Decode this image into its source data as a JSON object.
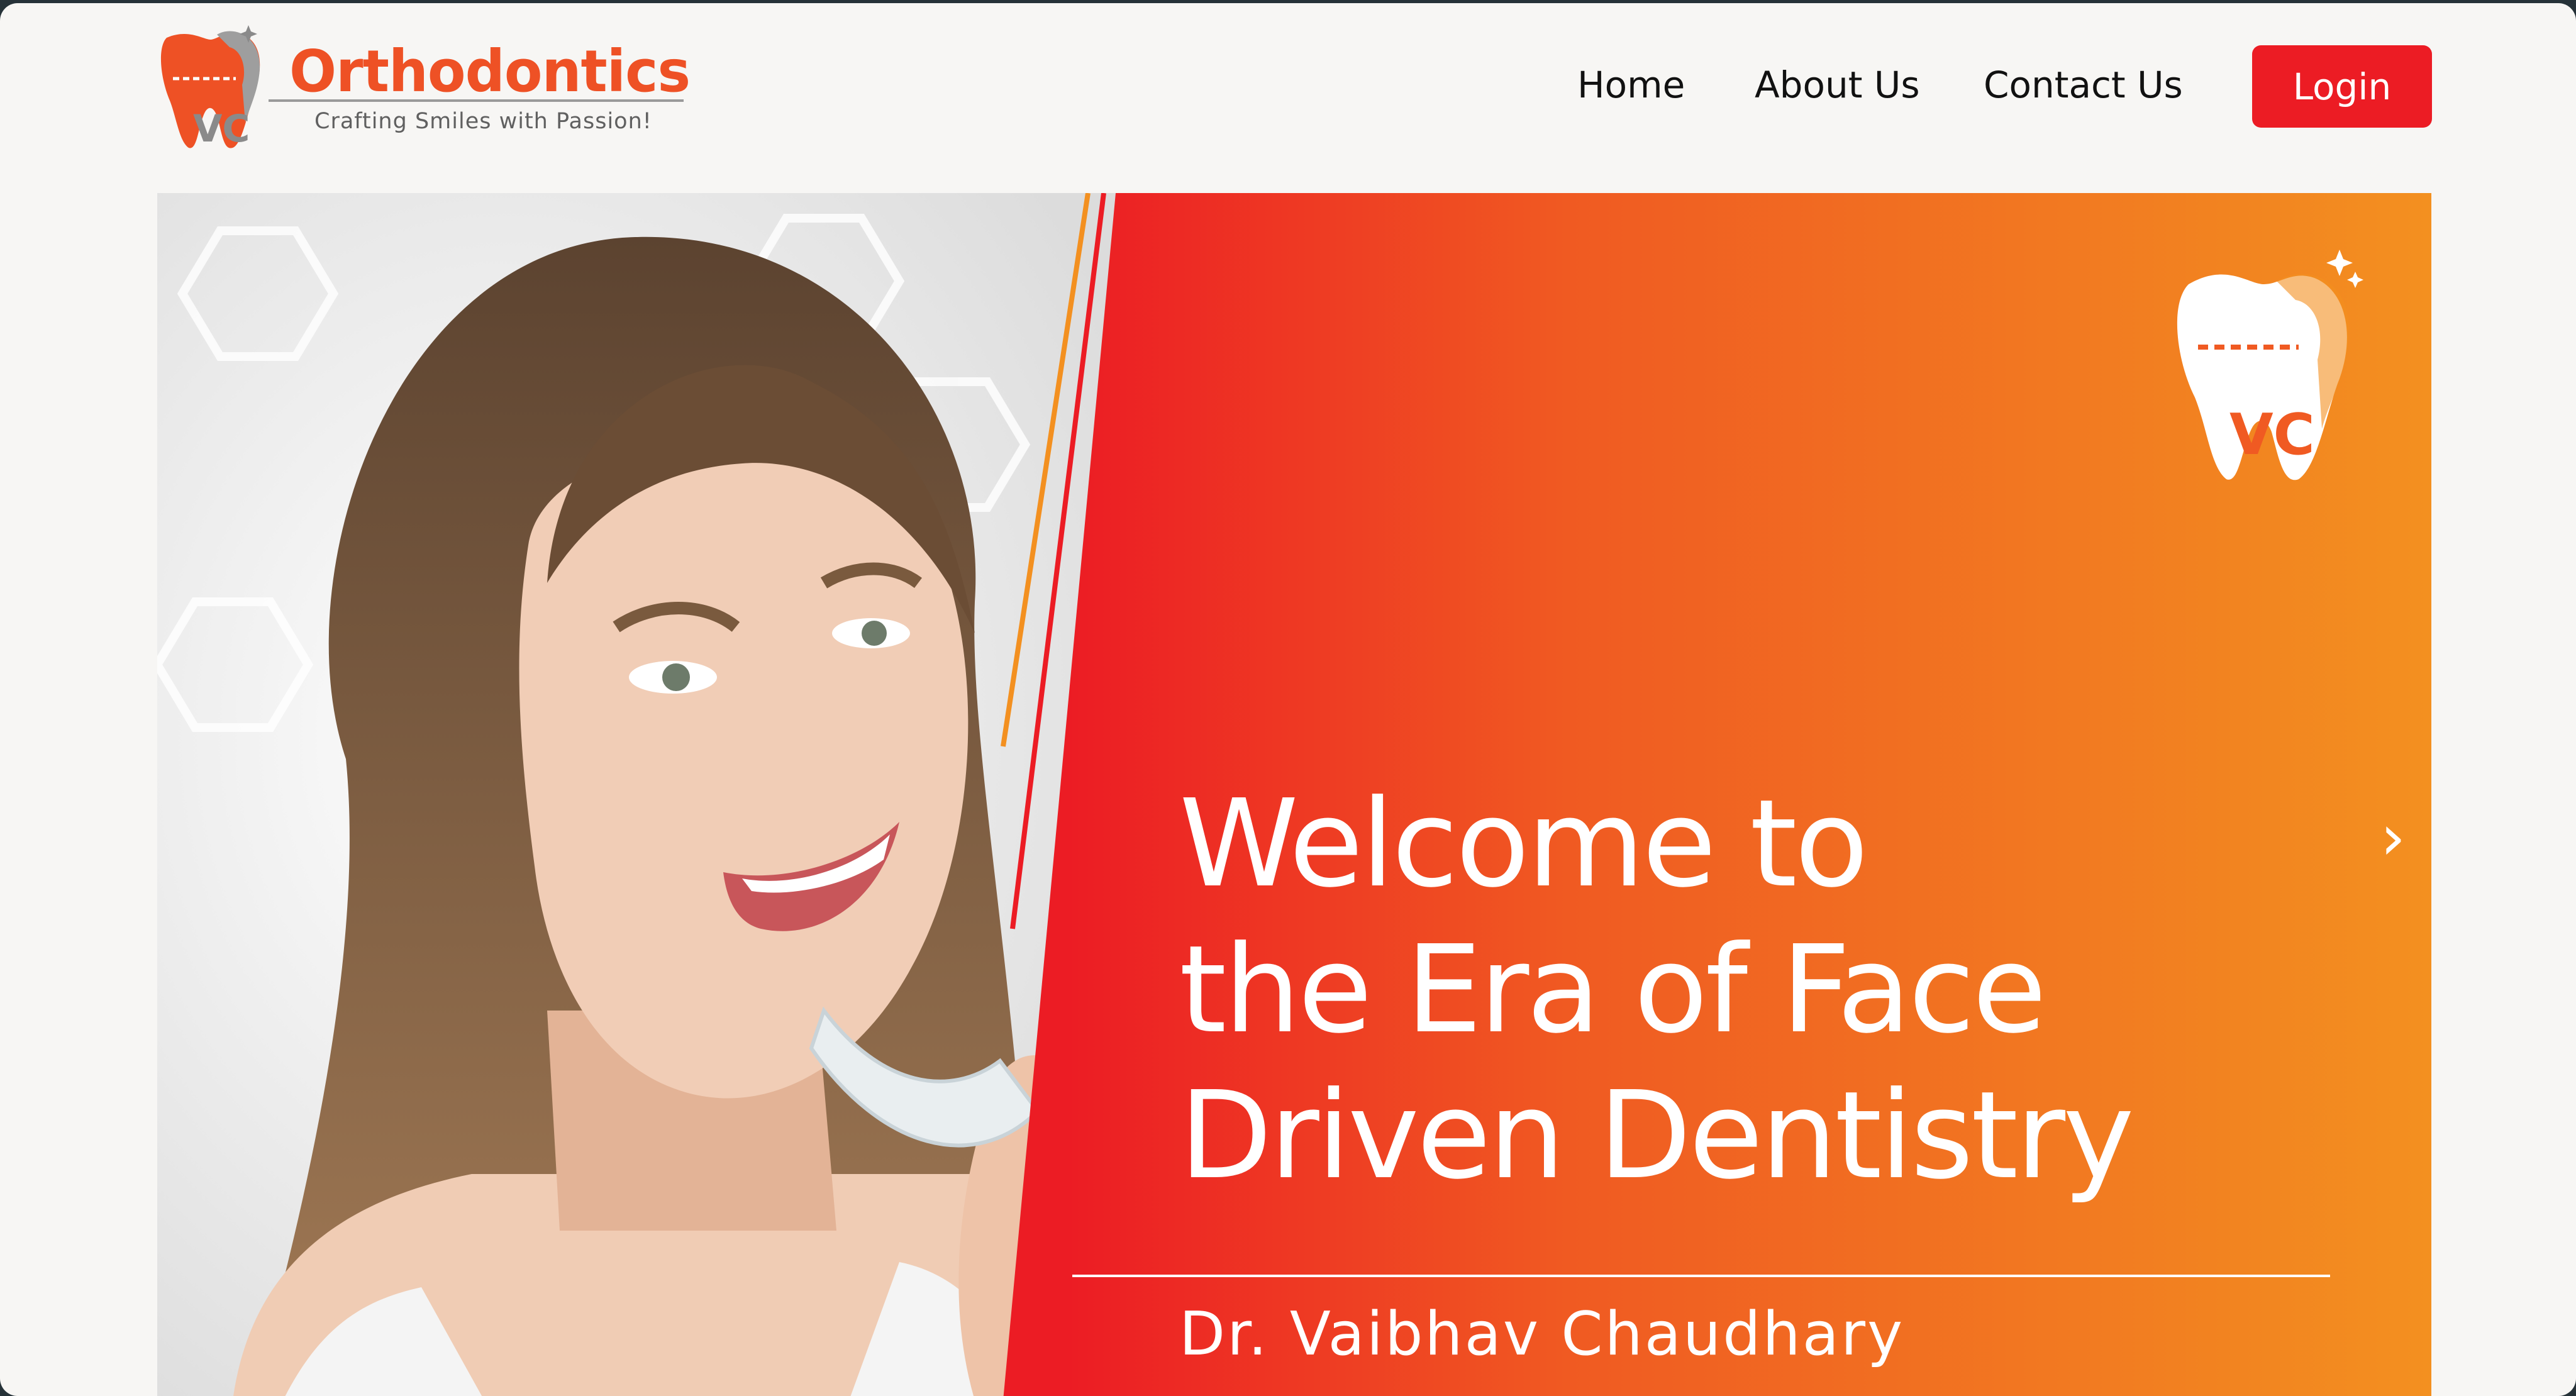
{
  "header": {
    "brand_name": "Orthodontics",
    "brand_tagline": "Crafting Smiles with Passion!",
    "logo_initials": "VC",
    "nav": [
      {
        "label": "Home"
      },
      {
        "label": "About Us"
      },
      {
        "label": "Contact Us"
      }
    ],
    "login_label": "Login"
  },
  "hero": {
    "title_lines": [
      "Welcome to",
      "the Era of Face",
      "Driven Dentistry"
    ],
    "doctor_name": "Dr. Vaibhav Chaudhary",
    "logo_initials": "VC",
    "next_arrow": "›",
    "next_icon": "chevron-right-icon"
  },
  "colors": {
    "brand_red": "#ec1c24",
    "brand_orange": "#f39020",
    "brand_text": "#ee5125"
  }
}
